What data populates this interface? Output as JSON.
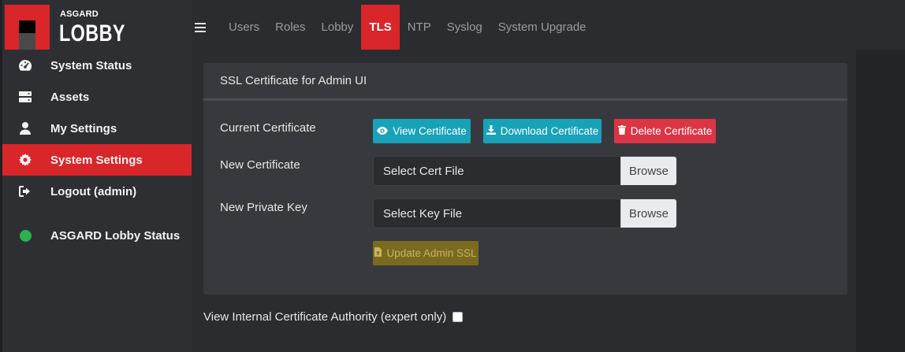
{
  "logo": {
    "small": "ASGARD",
    "big": "LOBBY"
  },
  "sidebar": {
    "items": [
      {
        "label": "System Status",
        "icon": "tachometer-icon"
      },
      {
        "label": "Assets",
        "icon": "server-icon"
      },
      {
        "label": "My Settings",
        "icon": "user-icon"
      },
      {
        "label": "System Settings",
        "icon": "gear-icon",
        "active": true
      },
      {
        "label": "Logout (admin)",
        "icon": "sign-out-icon"
      }
    ],
    "status": {
      "label": "ASGARD Lobby Status",
      "color": "#2bb24c"
    }
  },
  "topnav": {
    "tabs": [
      {
        "label": "Users"
      },
      {
        "label": "Roles"
      },
      {
        "label": "Lobby"
      },
      {
        "label": "TLS",
        "active": true
      },
      {
        "label": "NTP"
      },
      {
        "label": "Syslog"
      },
      {
        "label": "System Upgrade"
      }
    ]
  },
  "card": {
    "title": "SSL Certificate for Admin UI",
    "current_certificate_label": "Current Certificate",
    "view_button": "View Certificate",
    "download_button": "Download Certificate",
    "delete_button": "Delete Certificate",
    "new_certificate_label": "New Certificate",
    "cert_file_placeholder": "Select Cert File",
    "new_private_key_label": "New Private Key",
    "key_file_placeholder": "Select Key File",
    "browse_label": "Browse",
    "update_button": "Update Admin SSL"
  },
  "ca_toggle": {
    "label": "View Internal Certificate Authority (expert only)",
    "checked": false
  },
  "colors": {
    "accent": "#d8262b",
    "info": "#17a2b8",
    "danger": "#dc3545",
    "warning_disabled": "#7a6a1f",
    "status_ok": "#2bb24c"
  }
}
